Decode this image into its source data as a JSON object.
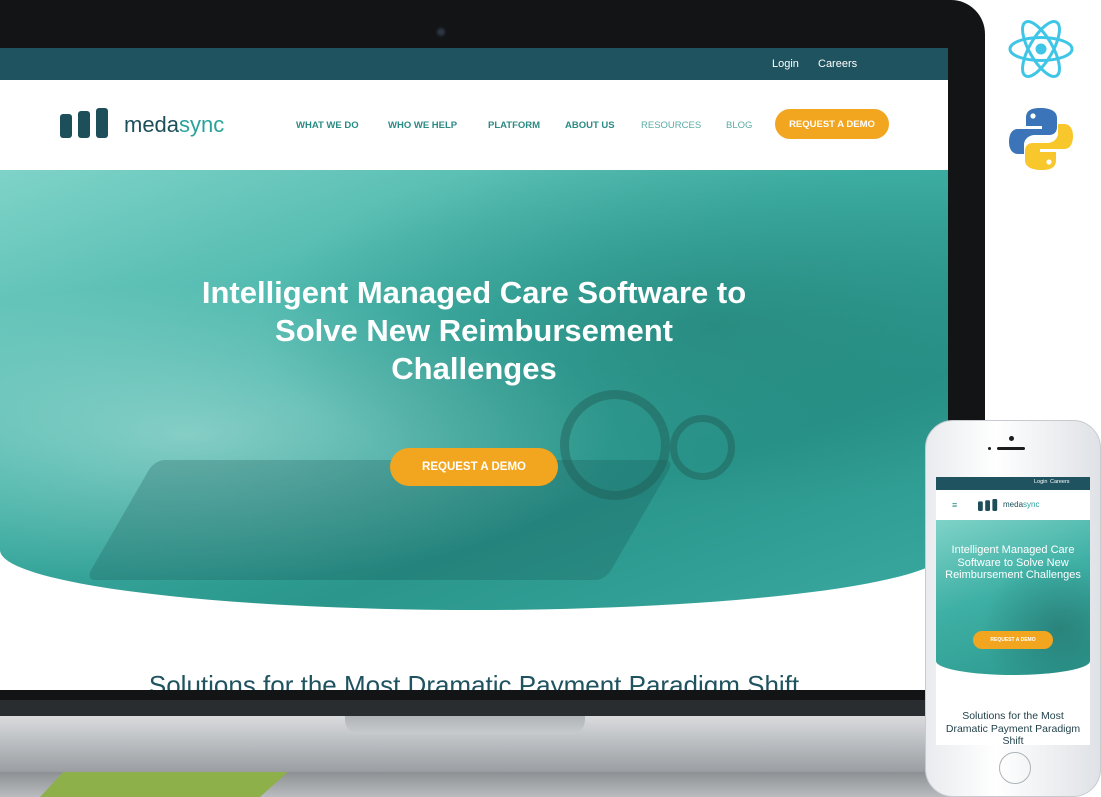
{
  "colors": {
    "brand_dark": "#1f5360",
    "brand_teal": "#2a8b84",
    "accent_orange": "#f2a51f"
  },
  "laptop": {
    "topbar": {
      "login": "Login",
      "careers": "Careers"
    },
    "logo": {
      "prefix": "meda",
      "suffix": "sync",
      "icon": "medasync-logo-icon"
    },
    "nav": {
      "items": [
        "WHAT WE DO",
        "WHO WE HELP",
        "PLATFORM",
        "ABOUT US",
        "RESOURCES",
        "BLOG"
      ],
      "cta": "REQUEST A DEMO"
    },
    "hero": {
      "title": "Intelligent Managed Care Software to Solve New Reimbursement Challenges",
      "cta": "REQUEST A DEMO"
    },
    "solutions_heading": "Solutions for the Most Dramatic Payment Paradigm Shift"
  },
  "phone": {
    "topbar": {
      "login": "Login",
      "careers": "Careers"
    },
    "menu_icon": "hamburger-icon",
    "logo": {
      "prefix": "meda",
      "suffix": "sync"
    },
    "hero": {
      "title": "Intelligent Managed Care Software to Solve New Reimbursement Challenges",
      "cta": "REQUEST A DEMO"
    },
    "solutions_heading": "Solutions for the Most Dramatic Payment Paradigm Shift"
  },
  "side_logos": [
    "react-logo-icon",
    "python-logo-icon"
  ]
}
